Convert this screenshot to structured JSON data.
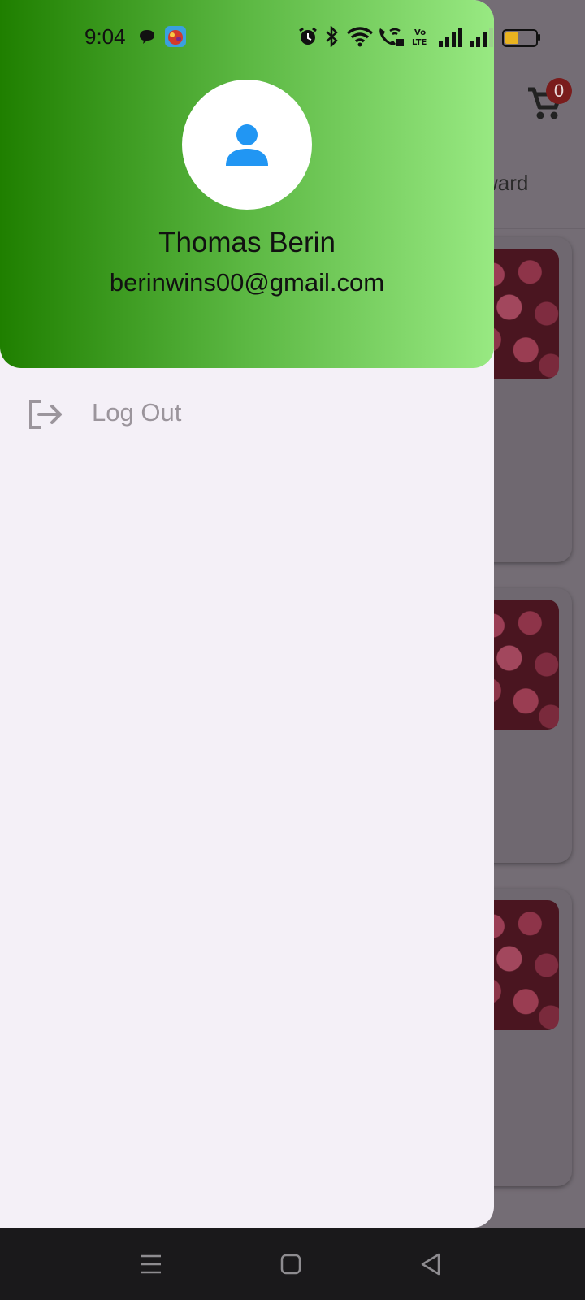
{
  "status_bar": {
    "time": "9:04",
    "icons": [
      "message-icon",
      "game-app-icon",
      "alarm-icon",
      "bluetooth-icon",
      "wifi-icon",
      "wifi-calling-icon",
      "volte-icon",
      "signal-icon",
      "signal-icon",
      "battery-icon"
    ],
    "battery_color": "#e9b320"
  },
  "background_app": {
    "cart_count": "0",
    "tab_partial_text": "ward",
    "card_count": 3
  },
  "drawer": {
    "user_name": "Thomas Berin",
    "user_email": "berinwins00@gmail.com",
    "avatar_icon": "person-icon",
    "avatar_color": "#2196f3",
    "header_gradient": [
      "#1f7f00",
      "#98e982"
    ],
    "menu": [
      {
        "label": "Log Out",
        "icon": "logout-icon"
      }
    ]
  },
  "nav_bar": {
    "buttons": [
      "menu-icon",
      "home-icon",
      "back-icon"
    ]
  }
}
